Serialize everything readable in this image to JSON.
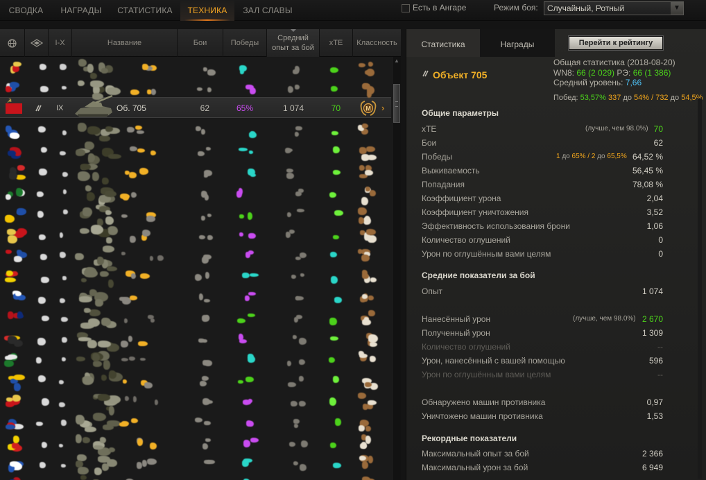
{
  "top_tabs": [
    {
      "label": "СВОДКА",
      "active": false
    },
    {
      "label": "НАГРАДЫ",
      "active": false
    },
    {
      "label": "СТАТИСТИКА",
      "active": false
    },
    {
      "label": "ТЕХНИКА",
      "active": true
    },
    {
      "label": "ЗАЛ СЛАВЫ",
      "active": false
    }
  ],
  "hangar_filter": {
    "label": "Есть в Ангаре",
    "checked": false
  },
  "battle_mode": {
    "label": "Режим боя:",
    "value": "Случайный, Ротный"
  },
  "table": {
    "headers": {
      "nation": "nation-globe-icon",
      "type": "vehicle-type-icon",
      "tier": "I-X",
      "name": "Название",
      "battles": "Бои",
      "wins": "Победы",
      "avg_xp": "Средний опыт за бой",
      "xte": "xTE",
      "mastery": "Классность"
    },
    "selected_row": {
      "tier": "IX",
      "name": "Об. 705",
      "battles": "62",
      "wins": "65%",
      "avg_xp": "1 074",
      "xte": "70",
      "mastery": "M"
    }
  },
  "colors": {
    "accent_orange": "#f5a623",
    "green": "#4cd11b",
    "gold": "#f1b026"
  },
  "right_panel": {
    "tabs": [
      {
        "label": "Статистика",
        "active": true
      },
      {
        "label": "Награды",
        "active": false
      }
    ],
    "rating_button": "Перейти к рейтингу",
    "vehicle_name": "Объект 705",
    "summary_line1": "Общая статистика (2018-08-20)",
    "summary_wn8_label": "WN8: ",
    "summary_wn8_val": "66 (2 029)",
    "summary_re_label": " РЭ: ",
    "summary_re_val": "66 (1 386)",
    "summary_level_label": "Средний уровень: ",
    "summary_level_val": "7,66",
    "win_label": "Побед: ",
    "win_val": "53,57%",
    "win_t1": " 337",
    "win_t2": " до ",
    "win_t3": "54%",
    "win_t4": " / 732",
    "win_t5": " до ",
    "win_t6": "54,5%",
    "sections": {
      "general": "Общие параметры",
      "average": "Средние показатели за бой",
      "records": "Рекордные показатели"
    },
    "general": {
      "xte": {
        "label": "xTE",
        "note": "(лучше, чем 98.0%)",
        "value": "70"
      },
      "battles": {
        "label": "Бои",
        "value": "62"
      },
      "wins": {
        "label": "Победы",
        "note_a": "1",
        "note_b": " до ",
        "note_c": "65%",
        "note_d": " / 2",
        "note_e": " до ",
        "note_f": "65,5%",
        "value": "64,52 %"
      },
      "survival": {
        "label": "Выживаемость",
        "value": "56,45 %"
      },
      "hits": {
        "label": "Попадания",
        "value": "78,08 %"
      },
      "damage_ratio": {
        "label": "Коэффициент урона",
        "value": "2,04"
      },
      "kill_ratio": {
        "label": "Коэффициент уничтожения",
        "value": "3,52"
      },
      "armor_eff": {
        "label": "Эффективность использования брони",
        "value": "1,06"
      },
      "stuns": {
        "label": "Количество оглушений",
        "value": "0"
      },
      "stun_dmg": {
        "label": "Урон по оглушённым вами целям",
        "value": "0"
      }
    },
    "average": {
      "xp": {
        "label": "Опыт",
        "value": "1 074"
      },
      "dealt": {
        "label": "Нанесённый урон",
        "note": "(лучше, чем 98.0%)",
        "value": "2 670"
      },
      "received": {
        "label": "Полученный урон",
        "value": "1 309"
      },
      "stuns": {
        "label": "Количество оглушений",
        "value": "--"
      },
      "assist": {
        "label": "Урон, нанесённый с вашей помощью",
        "value": "596"
      },
      "stun_dmg": {
        "label": "Урон по оглушённым вами целям",
        "value": "--"
      },
      "spotted": {
        "label": "Обнаружено машин противника",
        "value": "0,97"
      },
      "destroyed": {
        "label": "Уничтожено машин противника",
        "value": "1,53"
      }
    },
    "records": {
      "max_xp": {
        "label": "Максимальный опыт за бой",
        "value": "2 366"
      },
      "max_dmg": {
        "label": "Максимальный урон за бой",
        "value": "6 949"
      }
    }
  }
}
